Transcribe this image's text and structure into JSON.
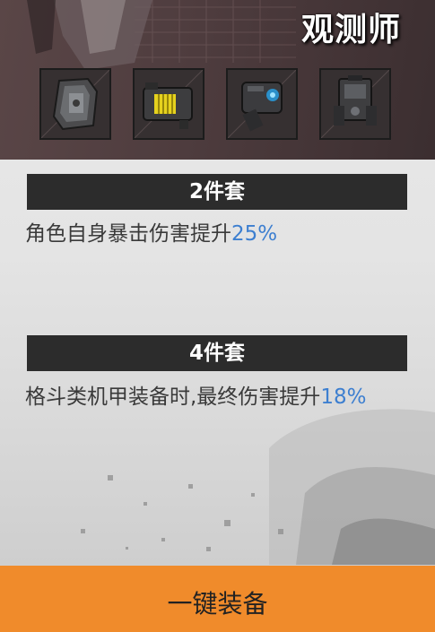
{
  "set_name": "观测师",
  "equipment": [
    {
      "icon": "armor-plate-icon"
    },
    {
      "icon": "battery-module-icon"
    },
    {
      "icon": "scope-module-icon"
    },
    {
      "icon": "backpack-module-icon"
    }
  ],
  "bonuses": [
    {
      "label": "2件套",
      "text": "角色自身暴击伤害提升",
      "value": "25%"
    },
    {
      "label": "4件套",
      "text": "格斗类机甲装备时,最终伤害提升",
      "value": "18%"
    }
  ],
  "equip_all_label": "一键装备",
  "colors": {
    "accent": "#f08b2b",
    "highlight": "#3d7fd0",
    "section_bar": "#2c2c2c"
  }
}
